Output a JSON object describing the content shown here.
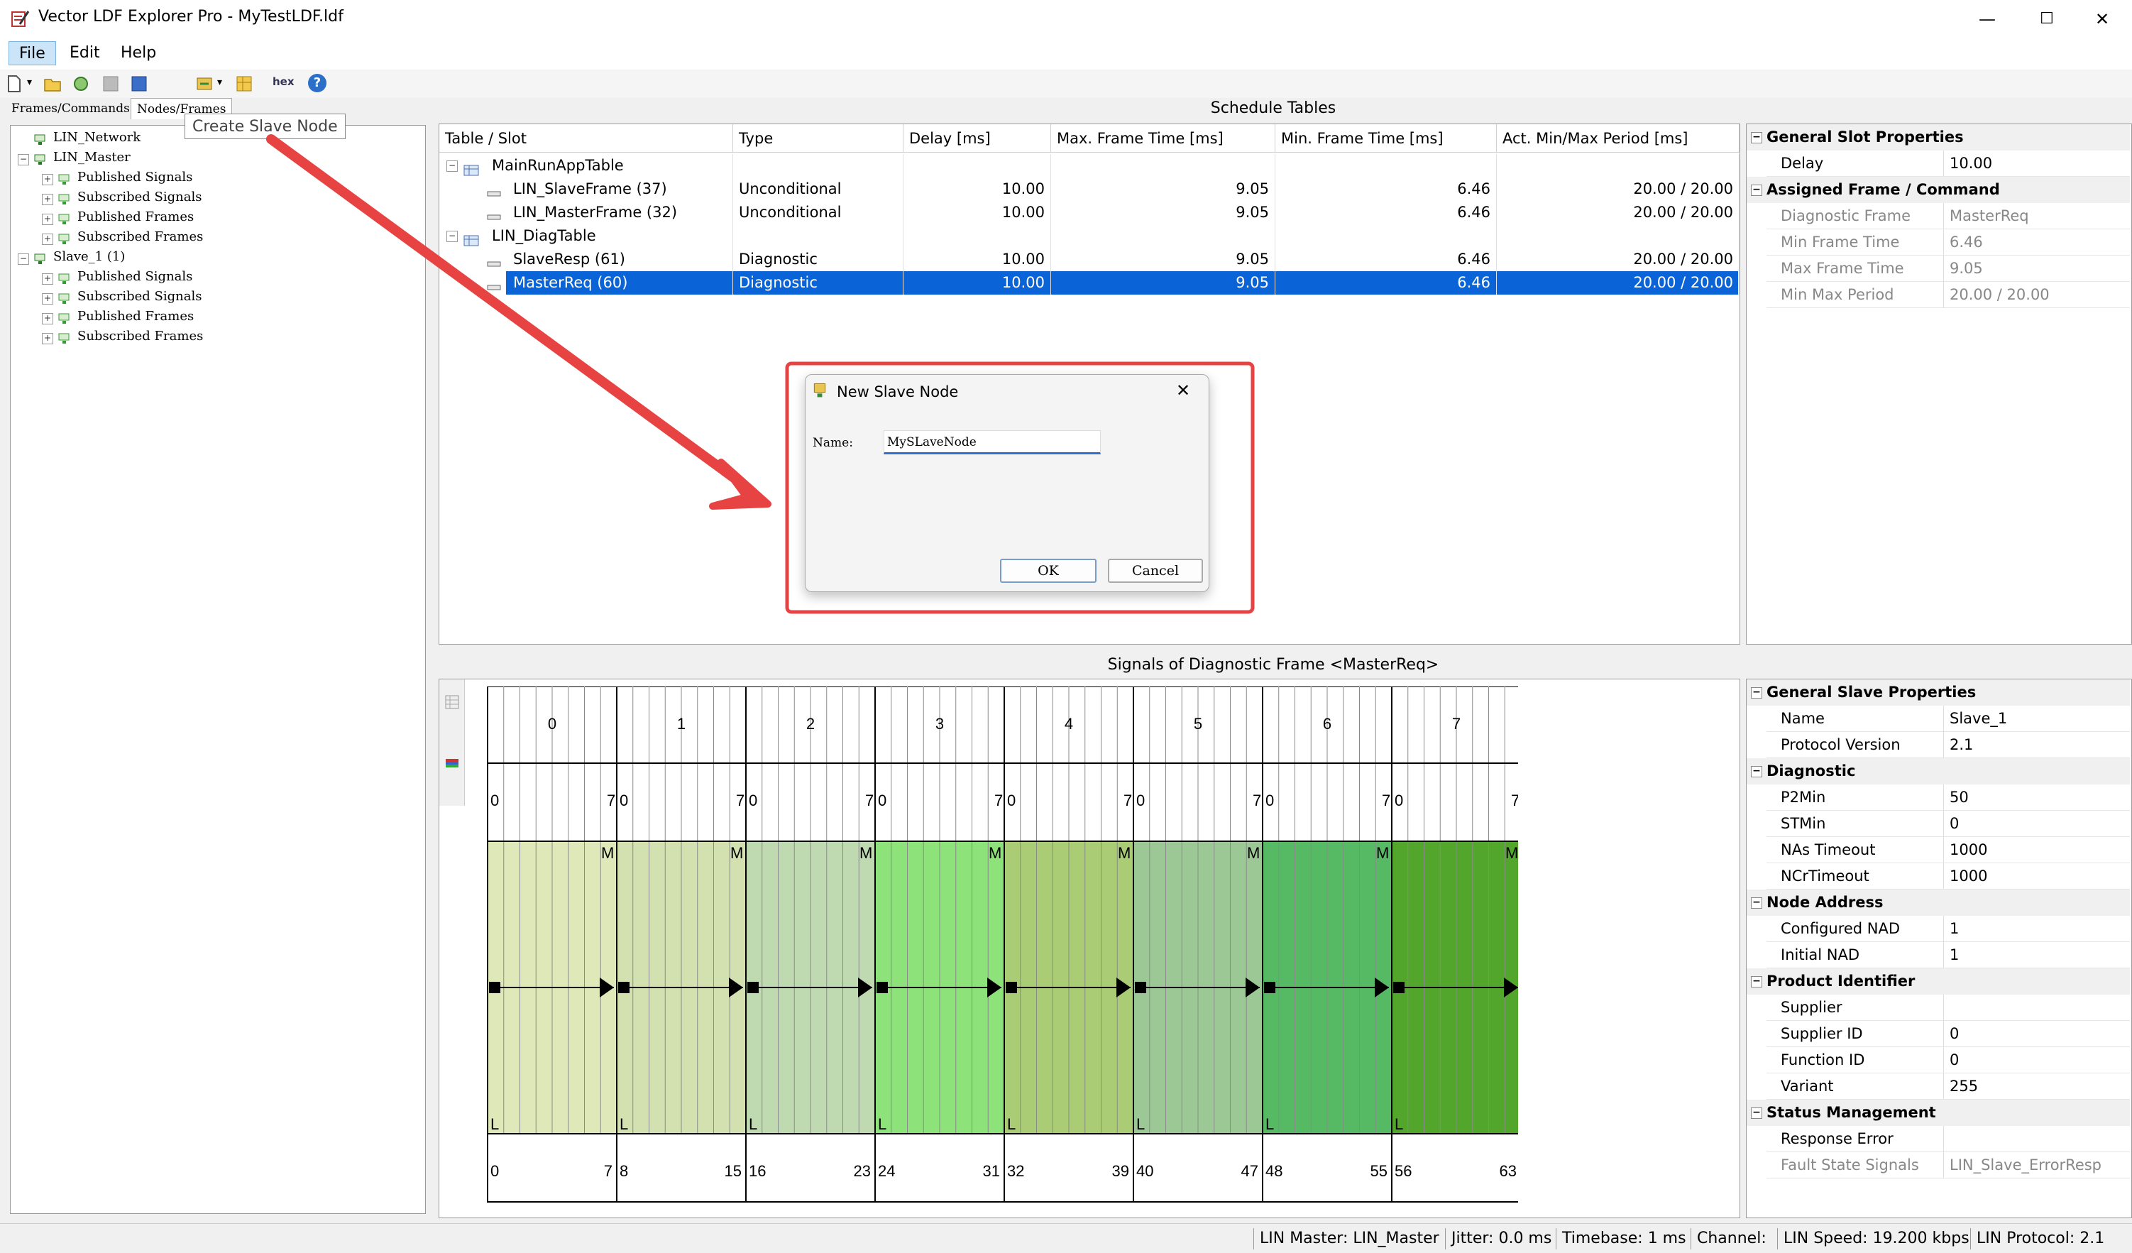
{
  "window": {
    "title": "Vector LDF Explorer Pro - MyTestLDF.ldf",
    "minimize": "—",
    "maximize": "☐",
    "close": "✕"
  },
  "menu": [
    "File",
    "Edit",
    "Help"
  ],
  "toolbar": {
    "hex_label": "hex",
    "help_label": "?"
  },
  "tabs": [
    "Frames/Commands",
    "Nodes/Frames"
  ],
  "tooltip": "Create Slave Node",
  "tree": [
    {
      "label": "LIN_Network",
      "level": 0
    },
    {
      "label": "LIN_Master",
      "level": 0
    },
    {
      "label": "Published Signals",
      "level": 1
    },
    {
      "label": "Subscribed Signals",
      "level": 1
    },
    {
      "label": "Published Frames",
      "level": 1
    },
    {
      "label": "Subscribed Frames",
      "level": 1
    },
    {
      "label": "Slave_1 (1)",
      "level": 0
    },
    {
      "label": "Published Signals",
      "level": 1
    },
    {
      "label": "Subscribed Signals",
      "level": 1
    },
    {
      "label": "Published Frames",
      "level": 1
    },
    {
      "label": "Subscribed Frames",
      "level": 1
    }
  ],
  "schedule": {
    "title": "Schedule Tables",
    "columns": [
      "Table / Slot",
      "Type",
      "Delay [ms]",
      "Max. Frame Time [ms]",
      "Min. Frame Time [ms]",
      "Act. Min/Max Period [ms]"
    ],
    "rows": [
      {
        "name": "MainRunAppTable",
        "kind": "table",
        "type": "",
        "delay": "",
        "max": "",
        "min": "",
        "period": ""
      },
      {
        "name": "LIN_SlaveFrame (37)",
        "kind": "slot",
        "type": "Unconditional",
        "delay": "10.00",
        "max": "9.05",
        "min": "6.46",
        "period": "20.00 / 20.00"
      },
      {
        "name": "LIN_MasterFrame (32)",
        "kind": "slot",
        "type": "Unconditional",
        "delay": "10.00",
        "max": "9.05",
        "min": "6.46",
        "period": "20.00 / 20.00"
      },
      {
        "name": "LIN_DiagTable",
        "kind": "table",
        "type": "",
        "delay": "",
        "max": "",
        "min": "",
        "period": ""
      },
      {
        "name": "SlaveResp (61)",
        "kind": "slot",
        "type": "Diagnostic",
        "delay": "10.00",
        "max": "9.05",
        "min": "6.46",
        "period": "20.00 / 20.00"
      },
      {
        "name": "MasterReq (60)",
        "kind": "slot",
        "type": "Diagnostic",
        "delay": "10.00",
        "max": "9.05",
        "min": "6.46",
        "period": "20.00 / 20.00",
        "selected": true
      }
    ]
  },
  "slot_props": [
    {
      "category": "General Slot Properties",
      "items": [
        {
          "k": "Delay",
          "v": "10.00",
          "ro": false
        }
      ]
    },
    {
      "category": "Assigned Frame / Command",
      "items": [
        {
          "k": "Diagnostic Frame",
          "v": "MasterReq",
          "ro": true
        },
        {
          "k": "Min Frame Time",
          "v": "6.46",
          "ro": true
        },
        {
          "k": "Max Frame Time",
          "v": "9.05",
          "ro": true
        },
        {
          "k": "Min Max Period",
          "v": "20.00 / 20.00",
          "ro": true
        }
      ]
    }
  ],
  "dialog": {
    "title": "New Slave Node",
    "name_label": "Name:",
    "name_value": "MySLaveNode",
    "ok": "OK",
    "cancel": "Cancel",
    "close": "✕"
  },
  "signals": {
    "title": "Signals of Diagnostic Frame <MasterReq>",
    "bytes": [
      "0",
      "1",
      "2",
      "3",
      "4",
      "5",
      "6",
      "7"
    ],
    "bit_lo": "0",
    "bit_hi": "7",
    "msb_label": "M",
    "lsb_label": "L",
    "bit_ranges": [
      [
        "0",
        "7"
      ],
      [
        "8",
        "15"
      ],
      [
        "16",
        "23"
      ],
      [
        "24",
        "31"
      ],
      [
        "32",
        "39"
      ],
      [
        "40",
        "47"
      ],
      [
        "48",
        "55"
      ],
      [
        "56",
        "63"
      ]
    ],
    "colors": [
      "#dfe8b8",
      "#d3e0b0",
      "#bfd9b0",
      "#8ee27a",
      "#a9cc74",
      "#9cc896",
      "#56b964",
      "#52a62c"
    ]
  },
  "slave_props": [
    {
      "category": "General Slave Properties",
      "items": [
        {
          "k": "Name",
          "v": "Slave_1",
          "ro": false
        },
        {
          "k": "Protocol Version",
          "v": "2.1",
          "ro": false
        }
      ]
    },
    {
      "category": "Diagnostic",
      "items": [
        {
          "k": "P2Min",
          "v": "50",
          "ro": false
        },
        {
          "k": "STMin",
          "v": "0",
          "ro": false
        },
        {
          "k": "NAs Timeout",
          "v": "1000",
          "ro": false
        },
        {
          "k": "NCrTimeout",
          "v": "1000",
          "ro": false
        }
      ]
    },
    {
      "category": "Node Address",
      "items": [
        {
          "k": "Configured NAD",
          "v": "1",
          "ro": false
        },
        {
          "k": "Initial NAD",
          "v": "1",
          "ro": false
        }
      ]
    },
    {
      "category": "Product Identifier",
      "items": [
        {
          "k": "Supplier",
          "v": "",
          "ro": false
        },
        {
          "k": "Supplier ID",
          "v": "0",
          "ro": false
        },
        {
          "k": "Function ID",
          "v": "0",
          "ro": false
        },
        {
          "k": "Variant",
          "v": "255",
          "ro": false
        }
      ]
    },
    {
      "category": "Status Management",
      "items": [
        {
          "k": "Response Error Signal",
          "v": "",
          "ro": false
        },
        {
          "k": "Fault State Signals",
          "v": "LIN_Slave_ErrorResp",
          "ro": true
        }
      ]
    }
  ],
  "status": [
    "LIN Master: LIN_Master",
    "Jitter: 0.0 ms",
    "Timebase: 1 ms",
    "Channel:",
    "LIN Speed: 19.200 kbps",
    "LIN Protocol: 2.1"
  ]
}
